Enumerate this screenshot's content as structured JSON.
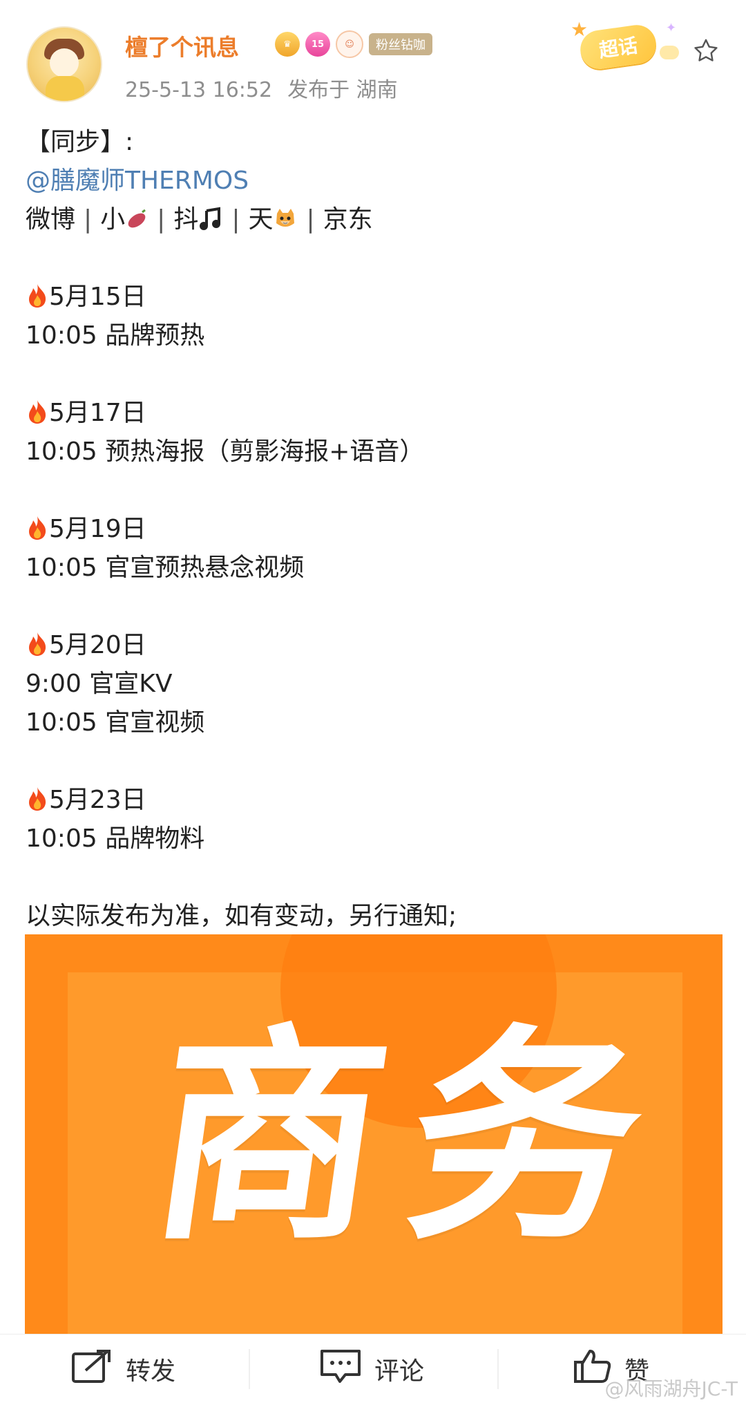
{
  "post": {
    "username": "檀了个讯息",
    "badge_level": "15",
    "fan_badge": "粉丝钻咖",
    "date": "25-5-13 16:52",
    "location": "发布于 湖南",
    "supertopic": "超话"
  },
  "content": {
    "sync": "【同步】:",
    "mention": "@膳魔师THERMOS",
    "platforms": [
      "微博",
      "小",
      "抖",
      "天",
      "京东"
    ],
    "schedule": [
      {
        "date": "5月15日",
        "items": [
          "10:05  品牌预热"
        ]
      },
      {
        "date": "5月17日",
        "items": [
          "10:05  预热海报（剪影海报+语音）"
        ]
      },
      {
        "date": "5月19日",
        "items": [
          "10:05  官宣预热悬念视频"
        ]
      },
      {
        "date": "5月20日",
        "items": [
          "9:00  官宣KV",
          "10:05  官宣视频"
        ]
      },
      {
        "date": "5月23日",
        "items": [
          "10:05  品牌物料"
        ]
      }
    ],
    "notice": "以实际发布为准，如有变动，另行通知;"
  },
  "image": {
    "text": "商务"
  },
  "actions": {
    "repost": "转发",
    "comment": "评论",
    "like": "赞"
  },
  "watermark": "@风雨湖舟JC-T",
  "colors": {
    "username": "#ec7d2b",
    "mention": "#4f7fb3",
    "image_bg": "#ff8a1a"
  }
}
